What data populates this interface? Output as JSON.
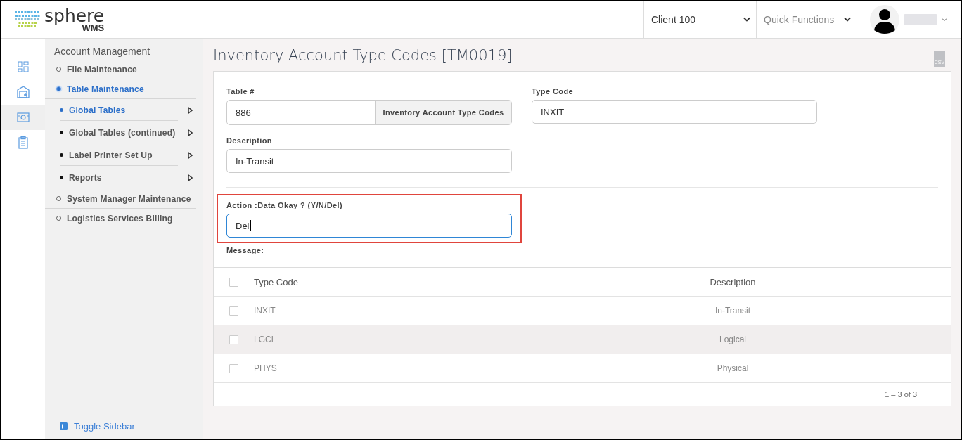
{
  "header": {
    "logo": {
      "name": "sphere",
      "sub": "WMS"
    },
    "client_select": {
      "value": "Client 100"
    },
    "quick_functions": {
      "placeholder": "Quick Functions"
    }
  },
  "icon_rail": [
    {
      "selected": false
    },
    {
      "selected": false
    },
    {
      "selected": true
    },
    {
      "selected": false
    }
  ],
  "sidebar": {
    "title": "Account Management",
    "items": [
      {
        "label": "File Maintenance",
        "selected": false
      },
      {
        "label": "Table Maintenance",
        "selected": true,
        "children": [
          {
            "label": "Global Tables",
            "selected": true
          },
          {
            "label": "Global Tables (continued)",
            "selected": false
          },
          {
            "label": "Label Printer Set Up",
            "selected": false
          },
          {
            "label": "Reports",
            "selected": false
          }
        ]
      },
      {
        "label": "System Manager Maintenance",
        "selected": false
      },
      {
        "label": "Logistics Services Billing",
        "selected": false
      }
    ],
    "toggle": "Toggle Sidebar"
  },
  "page": {
    "title": "Inventory Account Type Codes [TM0019]",
    "export_label": "CSV"
  },
  "form": {
    "table_number": {
      "label": "Table #",
      "value": "886",
      "addon": "Inventory Account Type Codes"
    },
    "type_code": {
      "label": "Type Code",
      "value": "INXIT"
    },
    "description": {
      "label": "Description",
      "value": "In-Transit"
    },
    "action": {
      "label": "Action :Data Okay ? (Y/N/Del)",
      "value": "Del",
      "focused": true,
      "highlighted": true
    },
    "message": {
      "label": "Message:"
    }
  },
  "table": {
    "header_checked": false,
    "columns": [
      "Type Code",
      "Description"
    ],
    "rows": [
      {
        "type_code": "INXIT",
        "description": "In-Transit",
        "checked": false,
        "highlighted": false
      },
      {
        "type_code": "LGCL",
        "description": "Logical",
        "checked": false,
        "highlighted": true
      },
      {
        "type_code": "PHYS",
        "description": "Physical",
        "checked": false,
        "highlighted": false
      }
    ],
    "pagination": "1 – 3 of 3"
  }
}
